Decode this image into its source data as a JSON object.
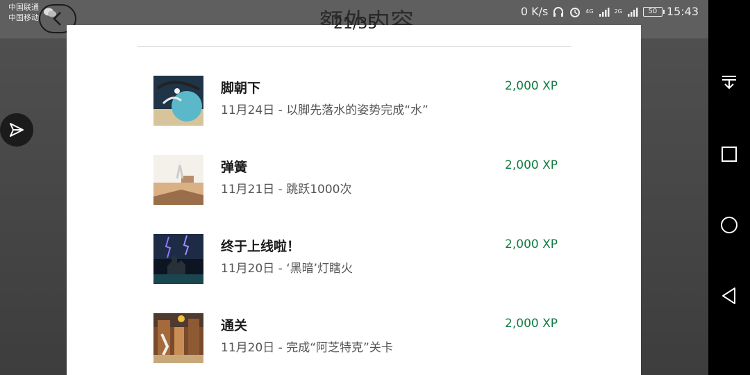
{
  "status_bar": {
    "carrier_1": "中国联通",
    "carrier_2": "中国移动",
    "net_speed": "0 K/s",
    "signal_1": "4G",
    "signal_2": "2G",
    "battery": "50",
    "time": "15:43"
  },
  "background": {
    "title": "额外内容",
    "counter": "21/35"
  },
  "achievements": [
    {
      "title": "脚朝下",
      "description": "11月24日 - 以脚先落水的姿势完成“水”",
      "xp": "2,000 XP",
      "thumb": "water-level-image"
    },
    {
      "title": "弹簧",
      "description": "11月21日 - 跳跃1000次",
      "xp": "2,000 XP",
      "thumb": "desert-level-image"
    },
    {
      "title": "终于上线啦！",
      "description": "11月20日 - ‘黑暗’灯瞎火",
      "xp": "2,000 XP",
      "thumb": "dark-castle-image"
    },
    {
      "title": "通关",
      "description": "11月20日 - 完成“阿芝特克”关卡",
      "xp": "2,000 XP",
      "thumb": "aztec-level-image"
    }
  ],
  "colors": {
    "xp_green": "#107c41",
    "dialog_bg": "#ffffff",
    "navbar_bg": "#000000"
  },
  "icons": {
    "back": "back-icon",
    "share": "share-icon",
    "nav_pulldown": "pull-down-icon",
    "nav_recent": "recent-apps-icon",
    "nav_home": "home-icon",
    "nav_back": "nav-back-icon"
  }
}
